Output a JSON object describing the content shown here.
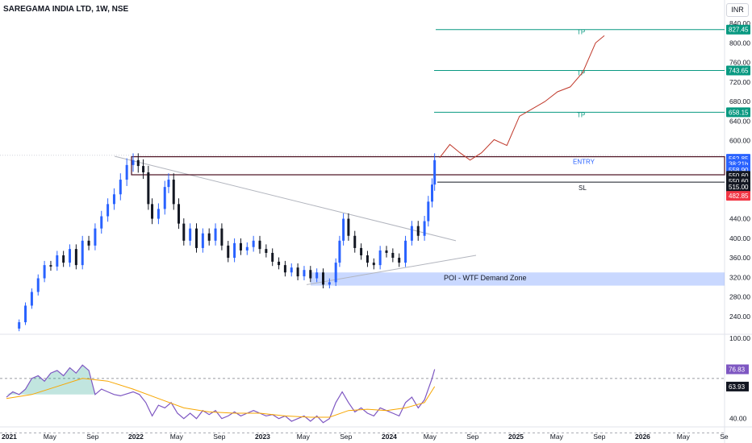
{
  "header": {
    "title": "SAREGAMA INDIA LTD, 1W, NSE",
    "currency_button": "INR"
  },
  "colors": {
    "up": "#2962ff",
    "down": "#131722",
    "tp": "#089981",
    "rsi": "#7e57c2",
    "rsi_ma": "#f7a600",
    "zone": "#2962ff",
    "trendline": "#b2b5be",
    "projection": "#c0392b"
  },
  "chart_data": [
    {
      "type": "candlestick",
      "title": "SAREGAMA INDIA LTD, 1W, NSE",
      "price_axis_ticks": [
        240,
        280,
        320,
        360,
        400,
        440,
        600,
        640,
        680,
        720,
        760,
        800,
        840
      ],
      "ylim": [
        205,
        855
      ],
      "x_tick_labels": [
        "2021",
        "May",
        "Sep",
        "2022",
        "May",
        "Sep",
        "2023",
        "May",
        "Sep",
        "2024",
        "May",
        "Sep",
        "2025",
        "May",
        "Sep",
        "2026",
        "May",
        "Se"
      ],
      "price_badges": [
        {
          "label": "827.45",
          "value": 827.45,
          "color": "#089981"
        },
        {
          "label": "743.65",
          "value": 743.65,
          "color": "#089981"
        },
        {
          "label": "658.15",
          "value": 658.15,
          "color": "#089981"
        },
        {
          "label": "562.85",
          "value": 562.85,
          "color": "#2962ff"
        },
        {
          "label": "38:21h",
          "value": 552.5,
          "color": "#2962ff"
        },
        {
          "label": "558.90",
          "value": 540,
          "color": "#2962ff"
        },
        {
          "label": "550.60",
          "value": 528,
          "color": "#131722"
        },
        {
          "label": "550.60",
          "value": 517,
          "color": "#131722"
        },
        {
          "label": "515.00",
          "value": 505,
          "color": "#131722"
        },
        {
          "label": "482.85",
          "value": 487,
          "color": "#f23645"
        }
      ],
      "levels": [
        {
          "label": "TP",
          "value": 827.45
        },
        {
          "label": "TP",
          "value": 743.65
        },
        {
          "label": "TP",
          "value": 658.15
        },
        {
          "label": "ENTRY",
          "value": 558.9
        },
        {
          "label": "SL",
          "value": 515.0
        }
      ],
      "zone_label": "POI - WTF Demand Zone",
      "zone_range": [
        303,
        330
      ],
      "close_series": [
        [
          2021.05,
          215
        ],
        [
          2021.1,
          228
        ],
        [
          2021.15,
          262
        ],
        [
          2021.2,
          290
        ],
        [
          2021.25,
          318
        ],
        [
          2021.3,
          345
        ],
        [
          2021.35,
          342
        ],
        [
          2021.4,
          365
        ],
        [
          2021.45,
          350
        ],
        [
          2021.5,
          378
        ],
        [
          2021.55,
          345
        ],
        [
          2021.6,
          395
        ],
        [
          2021.65,
          385
        ],
        [
          2021.7,
          420
        ],
        [
          2021.75,
          445
        ],
        [
          2021.8,
          470
        ],
        [
          2021.85,
          490
        ],
        [
          2021.9,
          520
        ],
        [
          2021.95,
          550
        ],
        [
          2022.0,
          560
        ],
        [
          2022.04,
          548
        ],
        [
          2022.08,
          535
        ],
        [
          2022.12,
          470
        ],
        [
          2022.15,
          440
        ],
        [
          2022.2,
          460
        ],
        [
          2022.25,
          505
        ],
        [
          2022.28,
          520
        ],
        [
          2022.32,
          470
        ],
        [
          2022.36,
          430
        ],
        [
          2022.4,
          395
        ],
        [
          2022.45,
          420
        ],
        [
          2022.5,
          380
        ],
        [
          2022.55,
          410
        ],
        [
          2022.6,
          395
        ],
        [
          2022.65,
          420
        ],
        [
          2022.7,
          385
        ],
        [
          2022.75,
          360
        ],
        [
          2022.8,
          390
        ],
        [
          2022.85,
          375
        ],
        [
          2022.9,
          382
        ],
        [
          2022.95,
          395
        ],
        [
          2023.0,
          378
        ],
        [
          2023.05,
          370
        ],
        [
          2023.1,
          352
        ],
        [
          2023.15,
          345
        ],
        [
          2023.2,
          330
        ],
        [
          2023.25,
          340
        ],
        [
          2023.3,
          322
        ],
        [
          2023.35,
          335
        ],
        [
          2023.4,
          318
        ],
        [
          2023.45,
          330
        ],
        [
          2023.5,
          305
        ],
        [
          2023.55,
          310
        ],
        [
          2023.6,
          350
        ],
        [
          2023.63,
          395
        ],
        [
          2023.66,
          440
        ],
        [
          2023.7,
          405
        ],
        [
          2023.75,
          380
        ],
        [
          2023.8,
          365
        ],
        [
          2023.85,
          350
        ],
        [
          2023.9,
          345
        ],
        [
          2023.95,
          375
        ],
        [
          2024.0,
          370
        ],
        [
          2024.05,
          360
        ],
        [
          2024.1,
          350
        ],
        [
          2024.15,
          395
        ],
        [
          2024.2,
          425
        ],
        [
          2024.25,
          405
        ],
        [
          2024.3,
          435
        ],
        [
          2024.33,
          475
        ],
        [
          2024.36,
          510
        ],
        [
          2024.38,
          560
        ]
      ]
    },
    {
      "type": "line",
      "ylim": [
        35,
        100
      ],
      "y_ticks": [
        40,
        100
      ],
      "current_value": "76.83",
      "ma_badge": "63.93",
      "series": [
        {
          "values": [
            [
              2021.0,
              56
            ],
            [
              2021.05,
              60
            ],
            [
              2021.1,
              58
            ],
            [
              2021.15,
              62
            ],
            [
              2021.2,
              70
            ],
            [
              2021.25,
              72
            ],
            [
              2021.3,
              68
            ],
            [
              2021.35,
              74
            ],
            [
              2021.4,
              76
            ],
            [
              2021.45,
              72
            ],
            [
              2021.5,
              78
            ],
            [
              2021.55,
              74
            ],
            [
              2021.6,
              80
            ],
            [
              2021.65,
              76
            ],
            [
              2021.7,
              58
            ],
            [
              2021.75,
              62
            ],
            [
              2021.8,
              60
            ],
            [
              2021.85,
              58
            ],
            [
              2021.9,
              57
            ],
            [
              2022.0,
              60
            ],
            [
              2022.05,
              58
            ],
            [
              2022.1,
              52
            ],
            [
              2022.15,
              42
            ],
            [
              2022.2,
              50
            ],
            [
              2022.25,
              48
            ],
            [
              2022.3,
              52
            ],
            [
              2022.35,
              44
            ],
            [
              2022.4,
              40
            ],
            [
              2022.45,
              44
            ],
            [
              2022.5,
              40
            ],
            [
              2022.55,
              46
            ],
            [
              2022.6,
              43
            ],
            [
              2022.65,
              46
            ],
            [
              2022.7,
              40
            ],
            [
              2022.75,
              42
            ],
            [
              2022.8,
              45
            ],
            [
              2022.85,
              42
            ],
            [
              2022.9,
              44
            ],
            [
              2022.95,
              46
            ],
            [
              2023.0,
              44
            ],
            [
              2023.05,
              42
            ],
            [
              2023.1,
              43
            ],
            [
              2023.15,
              40
            ],
            [
              2023.2,
              42
            ],
            [
              2023.25,
              38
            ],
            [
              2023.3,
              40
            ],
            [
              2023.35,
              42
            ],
            [
              2023.4,
              38
            ],
            [
              2023.45,
              42
            ],
            [
              2023.5,
              37
            ],
            [
              2023.55,
              40
            ],
            [
              2023.6,
              52
            ],
            [
              2023.65,
              60
            ],
            [
              2023.7,
              52
            ],
            [
              2023.75,
              45
            ],
            [
              2023.8,
              48
            ],
            [
              2023.85,
              44
            ],
            [
              2023.9,
              42
            ],
            [
              2023.95,
              48
            ],
            [
              2024.0,
              46
            ],
            [
              2024.05,
              44
            ],
            [
              2024.1,
              42
            ],
            [
              2024.15,
              52
            ],
            [
              2024.2,
              56
            ],
            [
              2024.25,
              48
            ],
            [
              2024.3,
              54
            ],
            [
              2024.33,
              62
            ],
            [
              2024.36,
              70
            ],
            [
              2024.38,
              76.83
            ]
          ]
        },
        {
          "values": [
            [
              2021.0,
              55
            ],
            [
              2021.2,
              58
            ],
            [
              2021.4,
              64
            ],
            [
              2021.6,
              70
            ],
            [
              2021.8,
              68
            ],
            [
              2022.0,
              62
            ],
            [
              2022.2,
              55
            ],
            [
              2022.4,
              48
            ],
            [
              2022.6,
              45
            ],
            [
              2022.8,
              44
            ],
            [
              2023.0,
              44
            ],
            [
              2023.2,
              42
            ],
            [
              2023.4,
              41
            ],
            [
              2023.55,
              41
            ],
            [
              2023.7,
              46
            ],
            [
              2023.85,
              47
            ],
            [
              2024.0,
              46
            ],
            [
              2024.15,
              48
            ],
            [
              2024.3,
              52
            ],
            [
              2024.38,
              63.93
            ]
          ]
        }
      ]
    }
  ]
}
